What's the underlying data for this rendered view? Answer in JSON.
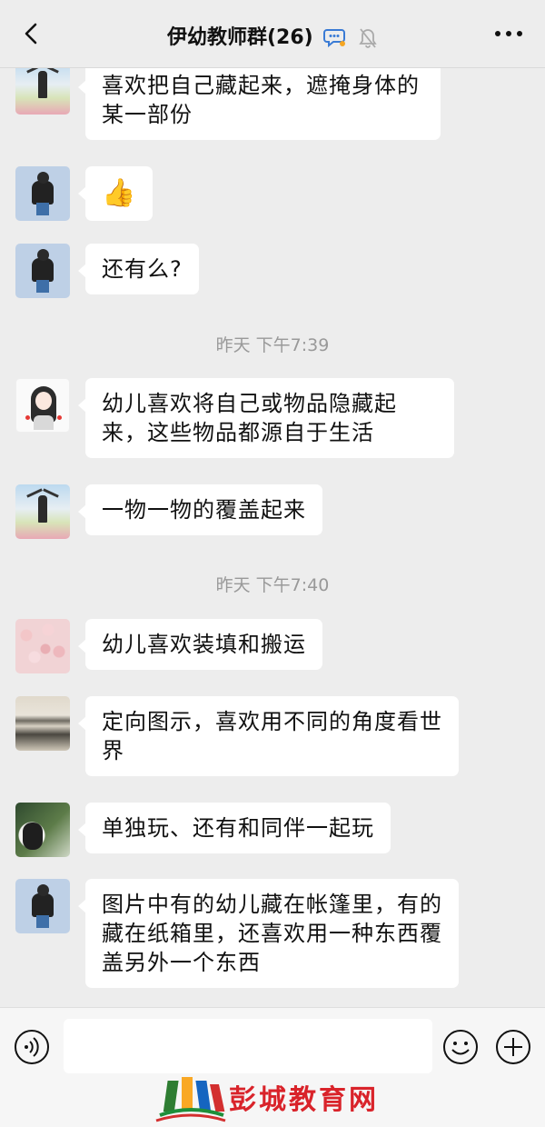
{
  "header": {
    "title": "伊幼教师群(26)",
    "icons": [
      "back-arrow-icon",
      "chat-bubble-icon",
      "mute-bell-icon",
      "more-dots-icon"
    ]
  },
  "messages": [
    {
      "avatar": "sky-girl-avatar",
      "text": "喜欢把自己藏起来，遮掩身体的某一部份"
    },
    {
      "avatar": "boy-avatar",
      "emoji": "👍"
    },
    {
      "avatar": "boy-avatar",
      "text": "还有么?"
    },
    {
      "time": "昨天 下午7:39"
    },
    {
      "avatar": "cartoon-girl-avatar",
      "text": "幼儿喜欢将自己或物品隐藏起来，这些物品都源自于生活"
    },
    {
      "avatar": "sky-girl-avatar",
      "text": "一物一物的覆盖起来"
    },
    {
      "time": "昨天 下午7:40"
    },
    {
      "avatar": "flowers-avatar",
      "text": "幼儿喜欢装填和搬运"
    },
    {
      "avatar": "building-avatar",
      "text": "定向图示，喜欢用不同的角度看世界"
    },
    {
      "avatar": "plant-girl-avatar",
      "text": "单独玩、还有和同伴一起玩"
    },
    {
      "avatar": "boy-avatar",
      "text": "图片中有的幼儿藏在帐篷里，有的藏在纸箱里，还喜欢用一种东西覆盖另外一个东西"
    }
  ],
  "input_bar": {
    "value": "",
    "icons": [
      "voice-icon",
      "emoji-icon",
      "plus-icon"
    ]
  },
  "watermark": {
    "text": "彭城教育网"
  },
  "colors": {
    "background": "#ededed",
    "bubble": "#ffffff",
    "timestamp": "#999999",
    "watermark": "#d9232a"
  }
}
